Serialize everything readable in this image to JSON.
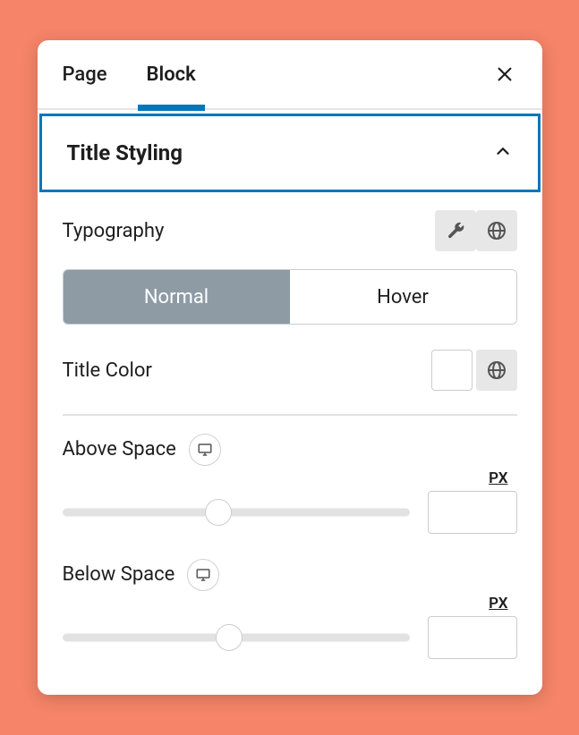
{
  "tabs": {
    "page": "Page",
    "block": "Block"
  },
  "section": {
    "title": "Title Styling"
  },
  "typography": {
    "label": "Typography"
  },
  "segments": {
    "normal": "Normal",
    "hover": "Hover"
  },
  "titleColor": {
    "label": "Title Color"
  },
  "aboveSpace": {
    "label": "Above Space",
    "unit": "PX",
    "value": "",
    "slider_percent": 45
  },
  "belowSpace": {
    "label": "Below Space",
    "unit": "PX",
    "value": "",
    "slider_percent": 48
  }
}
